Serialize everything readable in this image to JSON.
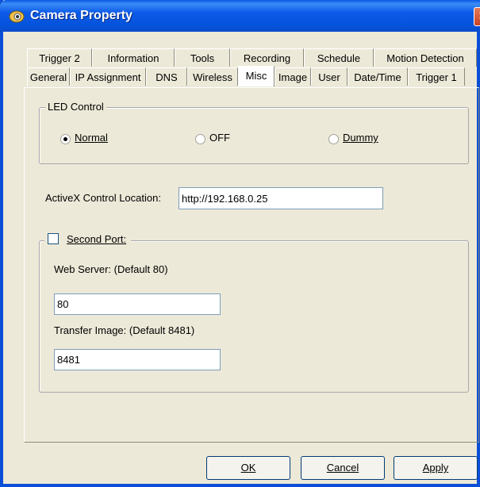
{
  "window": {
    "title": "Camera Property",
    "close_glyph": "✕",
    "title_icon": "camera-icon"
  },
  "tabs_row1": [
    "Trigger 2",
    "Information",
    "Tools",
    "Recording",
    "Schedule",
    "Motion Detection"
  ],
  "tabs_row2": [
    "General",
    "IP Assignment",
    "DNS",
    "Wireless",
    "Misc",
    "Image",
    "User",
    "Date/Time",
    "Trigger 1"
  ],
  "active_tab": "Misc",
  "led": {
    "group_label": "LED Control",
    "options": [
      {
        "label": "Normal",
        "selected": true
      },
      {
        "label": "OFF",
        "selected": false
      },
      {
        "label": "Dummy",
        "selected": false
      }
    ]
  },
  "activex": {
    "label": "ActiveX Control Location:",
    "value": "http://192.168.0.25"
  },
  "second_port": {
    "label": "Second Port:",
    "checked": false,
    "web_server_label": "Web Server: (Default 80)",
    "web_server_value": "80",
    "transfer_label": "Transfer Image: (Default 8481)",
    "transfer_value": "8481"
  },
  "buttons": {
    "ok": "OK",
    "cancel": "Cancel",
    "apply": "Apply"
  }
}
